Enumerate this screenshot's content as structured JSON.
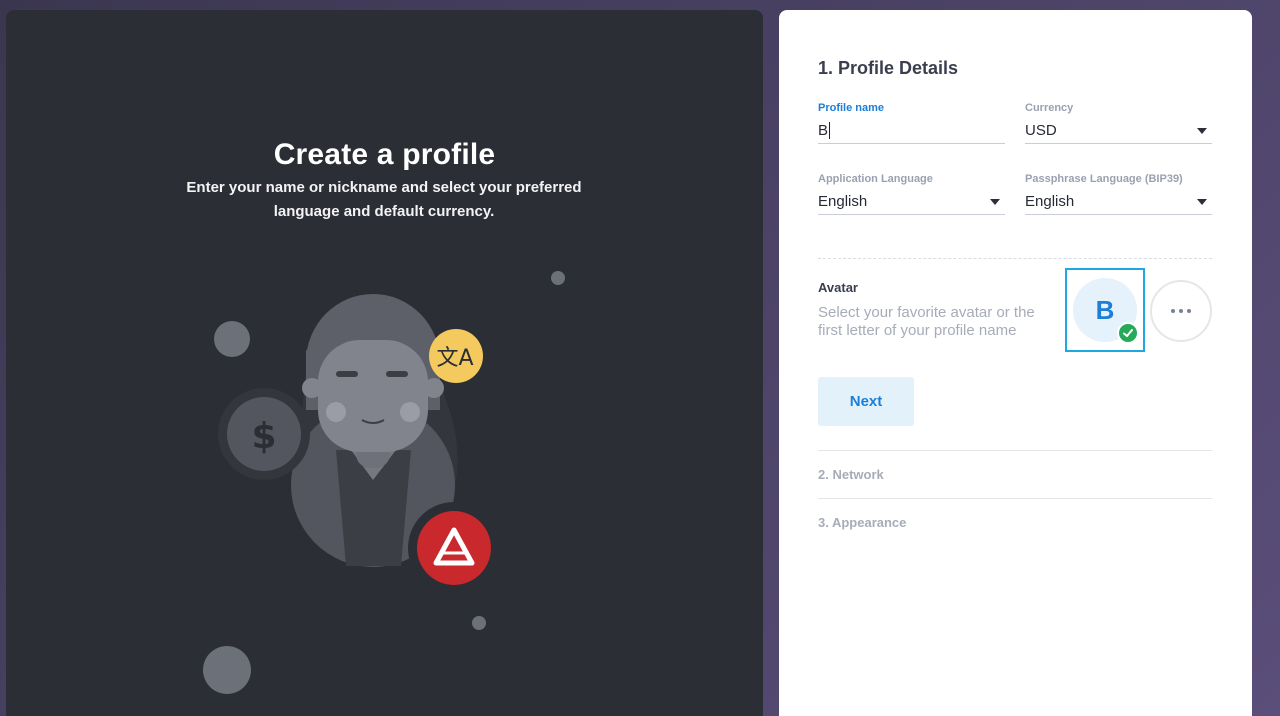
{
  "intro": {
    "title": "Create a profile",
    "description": "Enter your name or nickname and select your preferred language and default currency."
  },
  "form": {
    "step_title": "1. Profile Details",
    "profile_name": {
      "label": "Profile name",
      "value": "B"
    },
    "currency": {
      "label": "Currency",
      "value": "USD"
    },
    "app_language": {
      "label": "Application Language",
      "value": "English"
    },
    "passphrase_language": {
      "label": "Passphrase Language (BIP39)",
      "value": "English"
    },
    "avatar": {
      "title": "Avatar",
      "description": "Select your favorite avatar or the first letter of your profile name",
      "letter": "B"
    },
    "next_label": "Next"
  },
  "steps": [
    {
      "label": "2. Network"
    },
    {
      "label": "3. Appearance"
    }
  ],
  "icons": {
    "translate": "translate-icon",
    "dollar": "dollar-icon",
    "ark_logo": "ark-logo-icon",
    "checkmark": "check-icon",
    "more": "more-icon"
  },
  "colors": {
    "accent": "#1c7ed6",
    "success": "#27a95a",
    "ark_red": "#c9282d",
    "translate_yellow": "#f4c95d"
  }
}
